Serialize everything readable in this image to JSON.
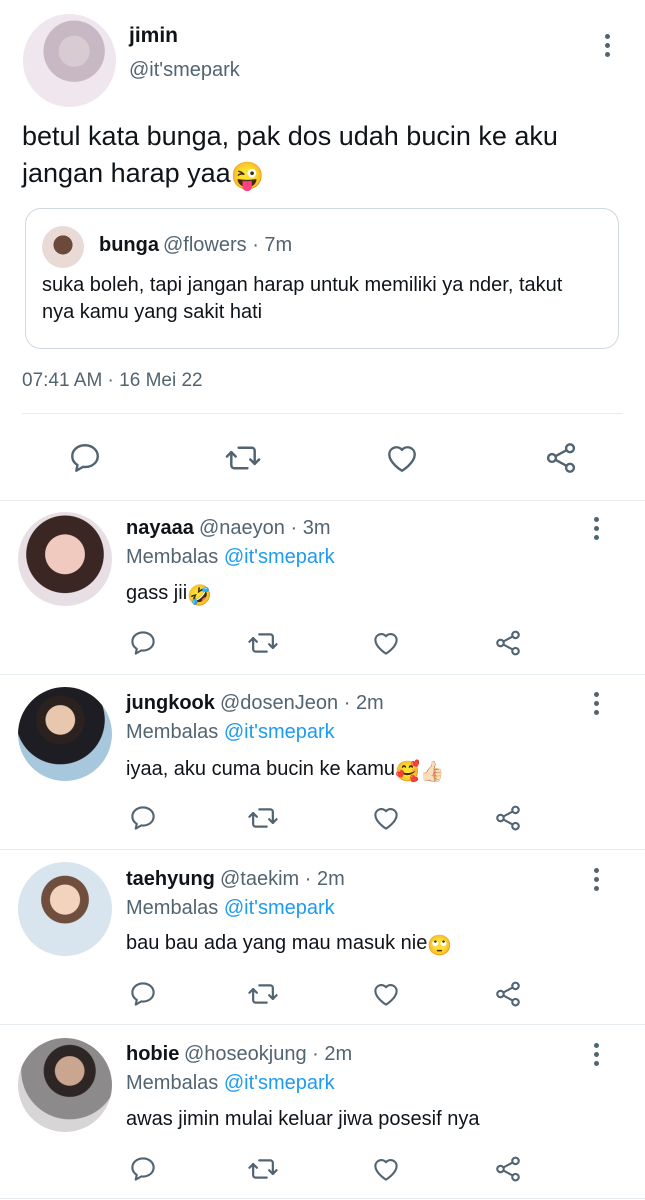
{
  "main_tweet": {
    "name": "jimin",
    "handle": "@it'smepark",
    "text_line1": "betul kata bunga, pak dos udah bucin ke aku",
    "text_line2": "jangan harap yaa",
    "emoji": "😜",
    "timestamp": "07:41 AM · 16 Mei 22",
    "quote": {
      "name": "bunga",
      "meta": "@flowers · 7m",
      "text_line1": "suka boleh, tapi jangan harap untuk memiliki ya nder, takut",
      "text_line2": "nya kamu yang sakit hati"
    }
  },
  "replies": [
    {
      "name": "nayaaa",
      "meta": "@naeyon · 3m",
      "replying_prefix": "Membalas",
      "replying_to": "@it'smepark",
      "text": "gass jii",
      "emoji": "🤣"
    },
    {
      "name": "jungkook",
      "meta": "@dosenJeon · 2m",
      "replying_prefix": "Membalas",
      "replying_to": "@it'smepark",
      "text": "iyaa, aku cuma bucin ke kamu",
      "emoji": "🥰👍🏻"
    },
    {
      "name": "taehyung",
      "meta": "@taekim · 2m",
      "replying_prefix": "Membalas",
      "replying_to": "@it'smepark",
      "text": "bau bau ada yang mau masuk nie",
      "emoji": "🙄"
    },
    {
      "name": "hobie",
      "meta": "@hoseokjung · 2m",
      "replying_prefix": "Membalas",
      "replying_to": "@it'smepark",
      "text": "awas jimin mulai keluar jiwa posesif nya",
      "emoji": ""
    }
  ],
  "icons": {
    "reply": "speech-bubble-icon",
    "retweet": "retweet-icon",
    "like": "heart-icon",
    "share": "share-icon",
    "more": "more-vertical-icon"
  },
  "colors": {
    "text": "#0f1419",
    "muted": "#536471",
    "accent": "#1d9bf0",
    "divider": "#e6ecf0"
  }
}
